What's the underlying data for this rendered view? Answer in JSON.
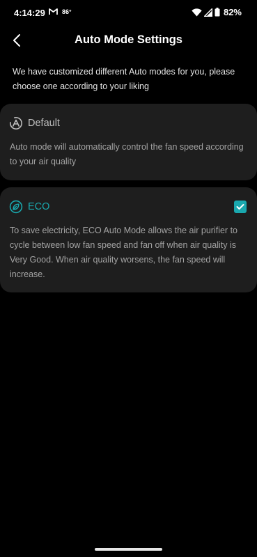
{
  "status_bar": {
    "time": "4:14:29",
    "temperature": "86°",
    "battery": "82%"
  },
  "header": {
    "title": "Auto Mode Settings"
  },
  "intro": "We have customized different Auto modes for you, please choose one according to your liking",
  "modes": [
    {
      "title": "Default",
      "description": "Auto mode will automatically control the fan speed according to your air quality",
      "selected": false,
      "icon": "auto-mode-icon"
    },
    {
      "title": "ECO",
      "description": "To save electricity, ECO Auto Mode allows the air purifier to cycle between low fan speed and fan off when air quality is Very Good. When air quality worsens, the fan speed will increase.",
      "selected": true,
      "icon": "eco-leaf-icon"
    }
  ],
  "colors": {
    "accent": "#1aa8ae",
    "card_background": "#1e1e1e",
    "background": "#000000"
  }
}
